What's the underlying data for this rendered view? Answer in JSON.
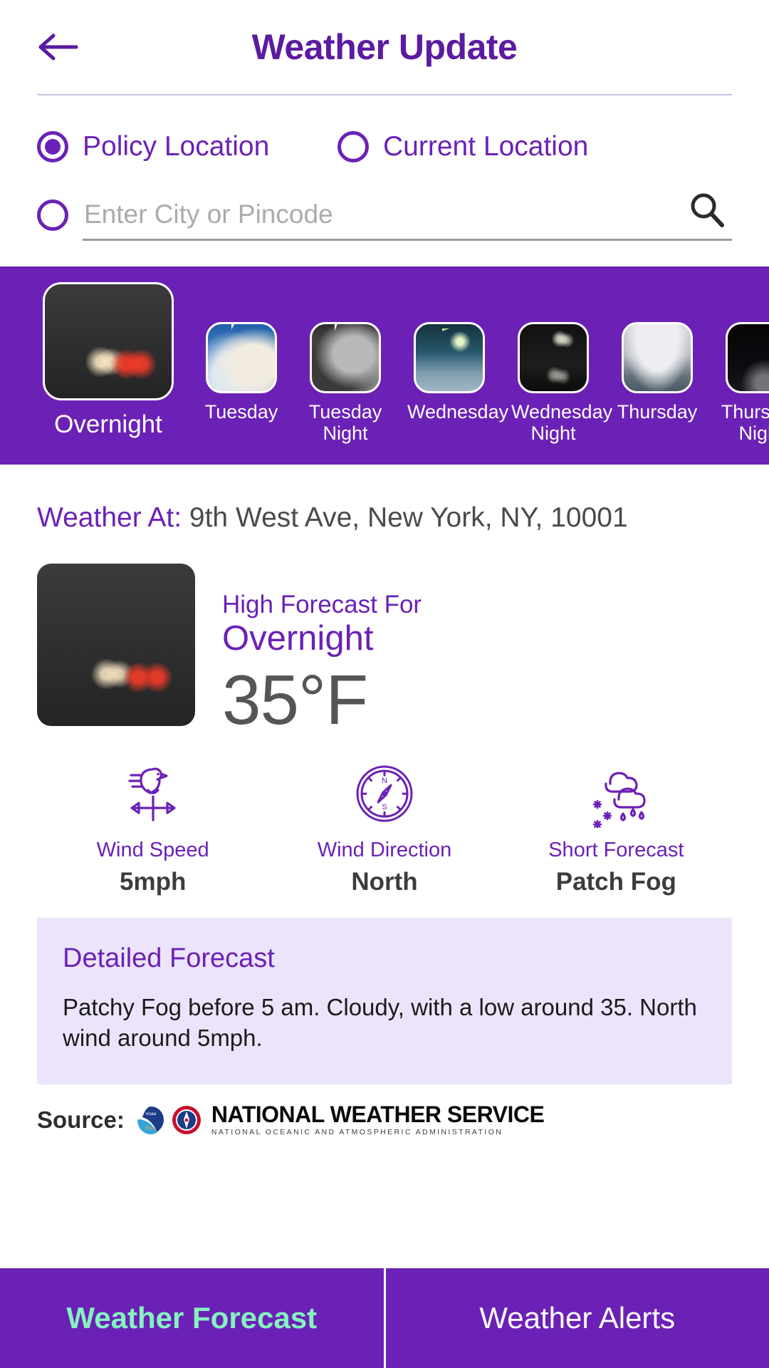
{
  "header": {
    "title": "Weather Update",
    "back_icon": "arrow-left-icon"
  },
  "location_options": {
    "policy": {
      "label": "Policy Location",
      "selected": true
    },
    "current": {
      "label": "Current Location",
      "selected": false
    },
    "manual": {
      "label": "",
      "selected": false,
      "placeholder": "Enter City or Pincode",
      "value": ""
    },
    "search_icon": "search-icon"
  },
  "forecast_carousel": [
    {
      "label": "Overnight",
      "scene": "fog",
      "active": true
    },
    {
      "label": "Tuesday",
      "scene": "thunderstorm-day",
      "active": false
    },
    {
      "label": "Tuesday Night",
      "scene": "thunderstorm-night",
      "active": false
    },
    {
      "label": "Wednesday",
      "scene": "lightning-rain",
      "active": false
    },
    {
      "label": "Wednesday Night",
      "scene": "night-lights",
      "active": false
    },
    {
      "label": "Thursday",
      "scene": "overcast",
      "active": false
    },
    {
      "label": "Thursday Night",
      "scene": "dark-night",
      "active": false
    }
  ],
  "weather_at": {
    "label": "Weather At:",
    "address": "9th West Ave, New York, NY, 10001"
  },
  "hero": {
    "sub_label": "High Forecast For",
    "period": "Overnight",
    "temperature": "35°F"
  },
  "stats": [
    {
      "icon": "weathervane-icon",
      "label": "Wind Speed",
      "value": "5mph"
    },
    {
      "icon": "compass-icon",
      "label": "Wind Direction",
      "value": "North"
    },
    {
      "icon": "cloud-rain-snow-icon",
      "label": "Short Forecast",
      "value": "Patch Fog"
    }
  ],
  "detailed_forecast": {
    "title": "Detailed Forecast",
    "text": "Patchy Fog before 5 am. Cloudy, with a low around 35. North wind around 5mph."
  },
  "source": {
    "label": "Source:",
    "noaa_logo": "noaa-logo-icon",
    "nws_logo": "nws-logo-icon",
    "name": "NATIONAL WEATHER SERVICE",
    "agency": "NATIONAL OCEANIC AND ATMOSPHERIC ADMINISTRATION"
  },
  "bottom_tabs": [
    {
      "label": "Weather Forecast",
      "active": true
    },
    {
      "label": "Weather Alerts",
      "active": false
    }
  ],
  "colors": {
    "brand_purple": "#6b21b6",
    "title_purple": "#5b1ba0",
    "accent_mint": "#85f2bf",
    "detail_bg": "#ece4fa"
  }
}
